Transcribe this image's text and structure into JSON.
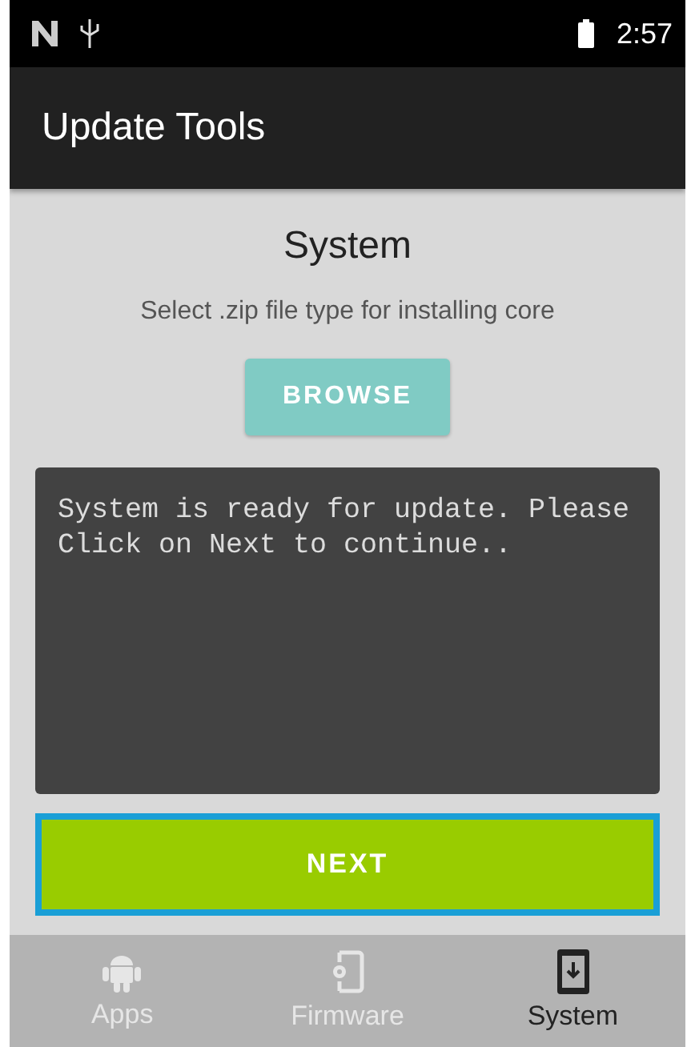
{
  "status_bar": {
    "time": "2:57"
  },
  "app_bar": {
    "title": "Update Tools"
  },
  "section": {
    "title": "System",
    "subtitle": "Select .zip file type for installing core"
  },
  "browse_button": {
    "label": "BROWSE"
  },
  "log": {
    "text": "System is ready for update. Please Click on Next to continue.."
  },
  "next_button": {
    "label": "NEXT",
    "focused": true
  },
  "bottom_nav": [
    {
      "kind": "apps",
      "label": "Apps",
      "selected": false
    },
    {
      "kind": "firmware",
      "label": "Firmware",
      "selected": false
    },
    {
      "kind": "system",
      "label": "System",
      "selected": true
    }
  ]
}
